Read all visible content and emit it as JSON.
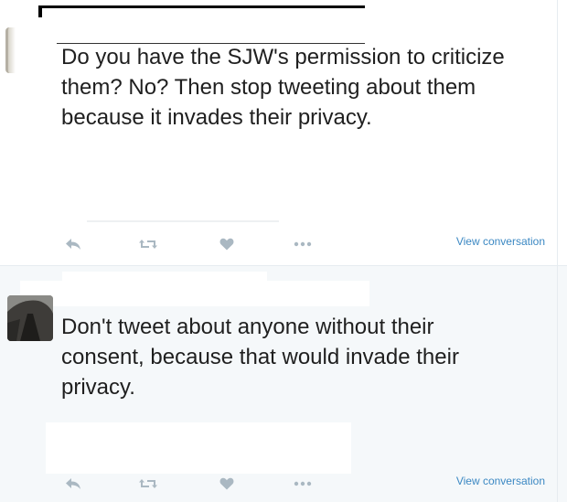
{
  "tweets": [
    {
      "text": "Do you have the SJW's permission to criticize them? No? Then stop tweeting about them because it invades their privacy.",
      "view_conversation": "View conversation",
      "actions": [
        "reply-icon",
        "retweet-icon",
        "like-icon",
        "more-icon"
      ]
    },
    {
      "text": "Don't tweet about anyone without their consent, because that would invade their privacy.",
      "view_conversation": "View conversation",
      "actions": [
        "reply-icon",
        "retweet-icon",
        "like-icon",
        "more-icon"
      ]
    }
  ],
  "colors": {
    "icon": "#aab8c2",
    "link": "#3b88c3",
    "text": "#1f1f1f",
    "alt_background": "#f5f8fa"
  }
}
